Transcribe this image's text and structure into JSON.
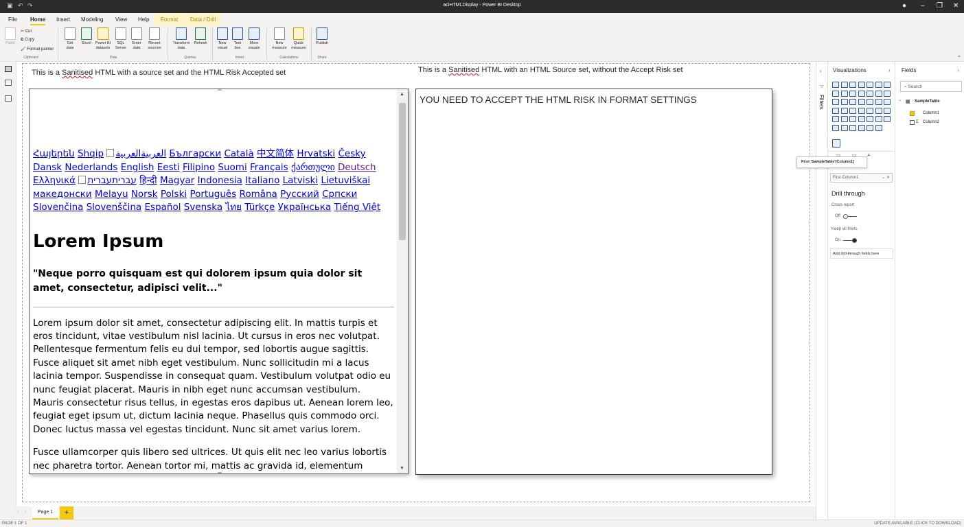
{
  "app": {
    "title": "aciHTMLDisplay - Power BI Desktop"
  },
  "menu": {
    "tabs": [
      "File",
      "Home",
      "Insert",
      "Modeling",
      "View",
      "Help",
      "Format",
      "Data / Drill"
    ]
  },
  "ribbon": {
    "clipboard": {
      "paste": "Paste",
      "cut": "Cut",
      "copy": "Copy",
      "format_painter": "Format painter",
      "group": "Clipboard"
    },
    "data": {
      "get_data": "Get\ndata",
      "excel": "Excel",
      "pbi_datasets": "Power BI\ndatasets",
      "sql": "SQL\nServer",
      "enter": "Enter\ndata",
      "recent": "Recent\nsources",
      "group": "Data"
    },
    "queries": {
      "transform": "Transform\ndata",
      "refresh": "Refresh",
      "group": "Queries"
    },
    "insert": {
      "new_visual": "New\nvisual",
      "text_box": "Text\nbox",
      "more_visuals": "More\nvisuals",
      "group": "Insert"
    },
    "calculations": {
      "new_measure": "New\nmeasure",
      "quick_measure": "Quick\nmeasure",
      "group": "Calculations"
    },
    "share": {
      "publish": "Publish",
      "group": "Share"
    }
  },
  "visual1": {
    "title_pre": "This is a ",
    "title_squig": "Sanitised",
    "title_post": " HTML with a source set and the HTML Risk Accepted set",
    "languages_row1": [
      "Հայերեն",
      "Shqip"
    ],
    "arabic_alt": "العربيةالعربية",
    "languages_row1b": [
      "Български",
      "Català",
      "中文简体",
      "Hrvatski",
      "Česky",
      "Dansk",
      "Nederlands",
      "English",
      "Eesti",
      "Filipino",
      "Suomi",
      "Français",
      "ქართული"
    ],
    "deutsch": "Deutsch",
    "languages_row3": [
      "Ελληνικά"
    ],
    "hebrew_alt": "עבריתעברית",
    "languages_row4": [
      "हिन्दी",
      "Magyar",
      "Indonesia",
      "Italiano",
      "Latviski",
      "Lietuviškai",
      "македонски",
      "Melayu",
      "Norsk",
      "Polski",
      "Português",
      "Româna",
      "Pусский",
      "Српски",
      "Slovenčina",
      "Slovenščina",
      "Español",
      "Svenska",
      "ไทย",
      "Türkçe",
      "Українська",
      "Tiếng Việt"
    ],
    "heading": "Lorem Ipsum",
    "quote": "\"Neque porro quisquam est qui dolorem ipsum quia dolor sit amet, consectetur, adipisci velit...\"",
    "para1": "Lorem ipsum dolor sit amet, consectetur adipiscing elit. In mattis turpis et eros tincidunt, vitae vestibulum nisl lacinia. Ut cursus in eros nec volutpat. Pellentesque fermentum felis eu dui tempor, sed lobortis augue sagittis. Fusce aliquet sit amet nibh eget vestibulum. Nunc sollicitudin mi a lacus lacinia tempor. Suspendisse in consequat quam. Vestibulum volutpat odio eu nunc feugiat placerat. Mauris in nibh eget nunc accumsan vestibulum. Mauris consectetur risus tellus, in egestas eros dapibus ut. Aenean lorem leo, feugiat eget ipsum ut, dictum lacinia neque. Phasellus quis commodo orci. Donec luctus massa vel egestas tincidunt. Nunc sit amet varius lorem.",
    "para2": "Fusce ullamcorper quis libero sed ultrices. Ut quis elit nec leo varius lobortis nec pharetra tortor. Aenean tortor mi, mattis ac gravida id, elementum dictum purus."
  },
  "visual2": {
    "title_pre": "This is a ",
    "title_squig": "Sanitised",
    "title_post": " HTML with an HTML Source set, without the Accept Risk set",
    "message": "YOU NEED TO ACCEPT THE HTML RISK IN FORMAT SETTINGS"
  },
  "pages": {
    "page1": "Page 1",
    "add": "+"
  },
  "status": {
    "left": "PAGE 1 OF 1",
    "right": "UPDATE AVAILABLE (CLICK TO DOWNLOAD)"
  },
  "panes": {
    "filters": "Filters",
    "visualizations": "Visualizations",
    "fields": "Fields",
    "search_placeholder": "Search",
    "table": "SampleTable",
    "columns": [
      "Column1",
      "Column2"
    ],
    "tooltip": "First 'SampleTable'[Column1]",
    "dropdown": "First Column1",
    "drill_title": "Drill through",
    "cross_report": "Cross-report",
    "off": "Off",
    "keep_filters": "Keep all filters",
    "on": "On",
    "add_drill": "Add drill-through fields here"
  },
  "colors": {
    "accent": "#f2c811",
    "link": "#0000ee",
    "visited": "#551a8b"
  }
}
